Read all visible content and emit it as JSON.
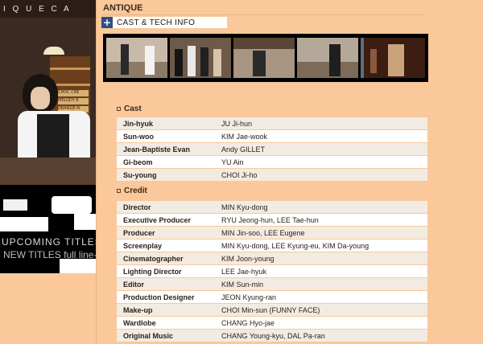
{
  "sidebar": {
    "hero_sign": "I Q U E   C A",
    "hero_tags": [
      "CHOC CRE",
      "MELODY R",
      "ORANGE-N"
    ],
    "promo_line1": "UPCOMING TITLES",
    "promo_line2": "NEW TITLES   full line-up"
  },
  "page": {
    "section_title": "ANTIQUE",
    "subhead": "CAST & TECH INFO"
  },
  "cast": {
    "heading": "Cast",
    "rows": [
      {
        "role": "Jin-hyuk",
        "name": "JU Ji-hun"
      },
      {
        "role": "Sun-woo",
        "name": "KIM Jae-wook"
      },
      {
        "role": "Jean-Baptiste Evan",
        "name": "Andy GILLET"
      },
      {
        "role": "Gi-beom",
        "name": "YU Ain"
      },
      {
        "role": "Su-young",
        "name": "CHOI Ji-ho"
      }
    ]
  },
  "credit": {
    "heading": "Credit",
    "rows": [
      {
        "role": "Director",
        "name": "MIN Kyu-dong"
      },
      {
        "role": "Executive Producer",
        "name": "RYU Jeong-hun, LEE Tae-hun"
      },
      {
        "role": "Producer",
        "name": "MIN Jin-soo, LEE Eugene"
      },
      {
        "role": "Screenplay",
        "name": "MIN Kyu-dong, LEE Kyung-eu, KIM Da-young"
      },
      {
        "role": "Cinematographer",
        "name": "KIM Joon-young"
      },
      {
        "role": "Lighting Director",
        "name": "LEE Jae-hyuk"
      },
      {
        "role": "Editor",
        "name": "KIM Sun-min"
      },
      {
        "role": "Production Designer",
        "name": "JEON Kyung-ran"
      },
      {
        "role": "Make-up",
        "name": "CHOI Min-sun (FUNNY FACE)"
      },
      {
        "role": "Wardlobe",
        "name": "CHANG Hyo-jae"
      },
      {
        "role": "Original Music",
        "name": "CHANG Young-kyu, DAL Pa-ran"
      }
    ]
  },
  "colors": {
    "background": "#fac89a",
    "accent": "#2f4f83",
    "row_odd": "#f1ebe2",
    "row_even": "#ffffff"
  }
}
